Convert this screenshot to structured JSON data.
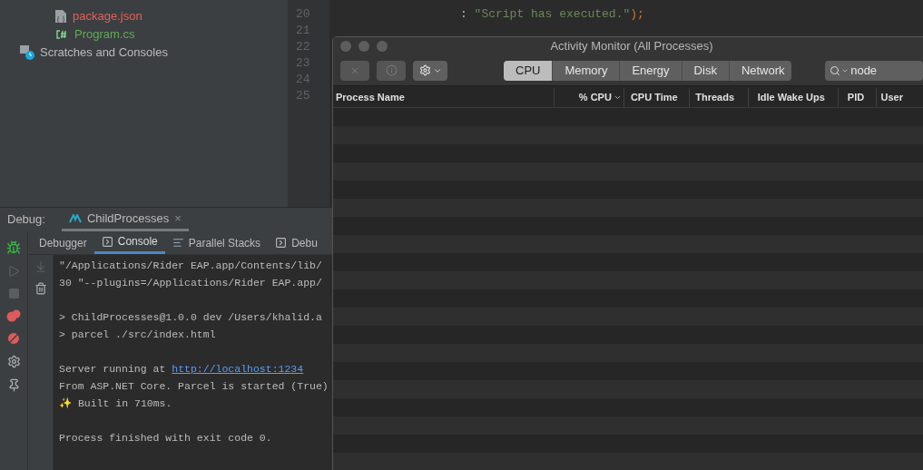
{
  "project_tree": {
    "items": [
      {
        "label": "package.json",
        "color": "#e0605a"
      },
      {
        "label": "Program.cs",
        "color": "#62a95a"
      },
      {
        "label": "Scratches and Consoles",
        "color": "#bbbbbb"
      }
    ]
  },
  "editor": {
    "line_numbers": [
      "20",
      "21",
      "22",
      "23",
      "24",
      "25"
    ],
    "code_line": {
      "prefix": ": ",
      "string": "\"Script has executed.\"",
      "suffix": ");"
    }
  },
  "debug": {
    "label": "Debug:",
    "session_tab": {
      "label": "ChildProcesses",
      "close": "×"
    },
    "tabs": [
      {
        "label": "Debugger",
        "selected": false
      },
      {
        "label": "Console",
        "selected": true
      },
      {
        "label": "Parallel Stacks",
        "selected": false
      },
      {
        "label": "Debu",
        "selected": false
      }
    ],
    "console_lines": [
      {
        "kind": "text",
        "text": "\"/Applications/Rider EAP.app/Contents/lib/"
      },
      {
        "kind": "text",
        "text": "30 \"--plugins=/Applications/Rider EAP.app/"
      },
      {
        "kind": "blank"
      },
      {
        "kind": "text",
        "text": "> ChildProcesses@1.0.0 dev /Users/khalid.a"
      },
      {
        "kind": "text",
        "text": "> parcel ./src/index.html"
      },
      {
        "kind": "blank"
      },
      {
        "kind": "link",
        "text": "Server running at ",
        "link": "http://localhost:1234"
      },
      {
        "kind": "text",
        "text": "From ASP.NET Core. Parcel is started (True)"
      },
      {
        "kind": "text",
        "text": "✨ Built in 710ms."
      },
      {
        "kind": "blank"
      },
      {
        "kind": "text",
        "text": "Process finished with exit code 0."
      }
    ]
  },
  "activity_monitor": {
    "window": {
      "title": "Activity Monitor (All Processes)"
    },
    "tabs": [
      {
        "label": "CPU",
        "selected": true
      },
      {
        "label": "Memory",
        "selected": false
      },
      {
        "label": "Energy",
        "selected": false
      },
      {
        "label": "Disk",
        "selected": false
      },
      {
        "label": "Network",
        "selected": false
      }
    ],
    "search": {
      "value": "node"
    },
    "table": {
      "columns": [
        {
          "label": "Process Name",
          "sorted": false
        },
        {
          "label": "% CPU",
          "sorted": true
        },
        {
          "label": "CPU Time",
          "sorted": false
        },
        {
          "label": "Threads",
          "sorted": false
        },
        {
          "label": "Idle Wake Ups",
          "sorted": false
        },
        {
          "label": "PID",
          "sorted": false
        },
        {
          "label": "User",
          "sorted": false
        }
      ]
    }
  }
}
